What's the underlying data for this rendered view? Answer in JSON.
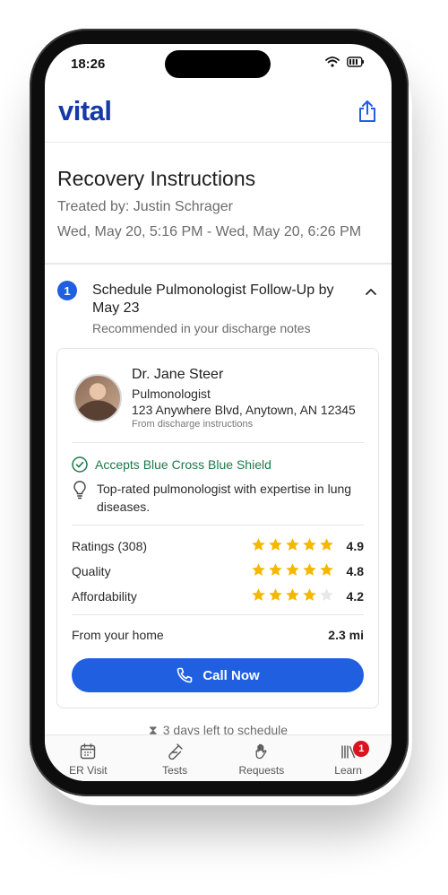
{
  "status_bar": {
    "time": "18:26"
  },
  "app": {
    "logo": "vital"
  },
  "visit": {
    "title": "Recovery Instructions",
    "treated_by": "Treated by: Justin Schrager",
    "time_range": "Wed, May 20, 5:16 PM - Wed, May 20, 6:26 PM"
  },
  "step": {
    "number": "1",
    "title": "Schedule Pulmonologist Follow-Up by May 23",
    "note": "Recommended in your discharge notes"
  },
  "doctor": {
    "name": "Dr. Jane Steer",
    "specialty": "Pulmonologist",
    "address": "123 Anywhere Blvd, Anytown, AN 12345",
    "source": "From discharge instructions",
    "insurance": "Accepts Blue Cross Blue Shield",
    "highlight": "Top-rated pulmonologist with expertise in lung diseases.",
    "ratings": [
      {
        "label": "Ratings (308)",
        "value": "4.9",
        "stars_filled": 5
      },
      {
        "label": "Quality",
        "value": "4.8",
        "stars_filled": 5
      },
      {
        "label": "Affordability",
        "value": "4.2",
        "stars_filled": 4
      }
    ],
    "distance_label": "From your home",
    "distance": "2.3 mi",
    "call_label": "Call Now"
  },
  "schedule_note": "3 days left to schedule",
  "tabs": [
    {
      "label": "ER Visit",
      "icon": "calendar-icon"
    },
    {
      "label": "Tests",
      "icon": "test-tube-icon"
    },
    {
      "label": "Requests",
      "icon": "hand-icon"
    },
    {
      "label": "Learn",
      "icon": "library-icon",
      "badge": "1"
    }
  ],
  "colors": {
    "brand": "#1638a8",
    "accent": "#1f5fe0",
    "success": "#1b7a4a",
    "star": "#f5b800",
    "badge": "#d9141f"
  }
}
